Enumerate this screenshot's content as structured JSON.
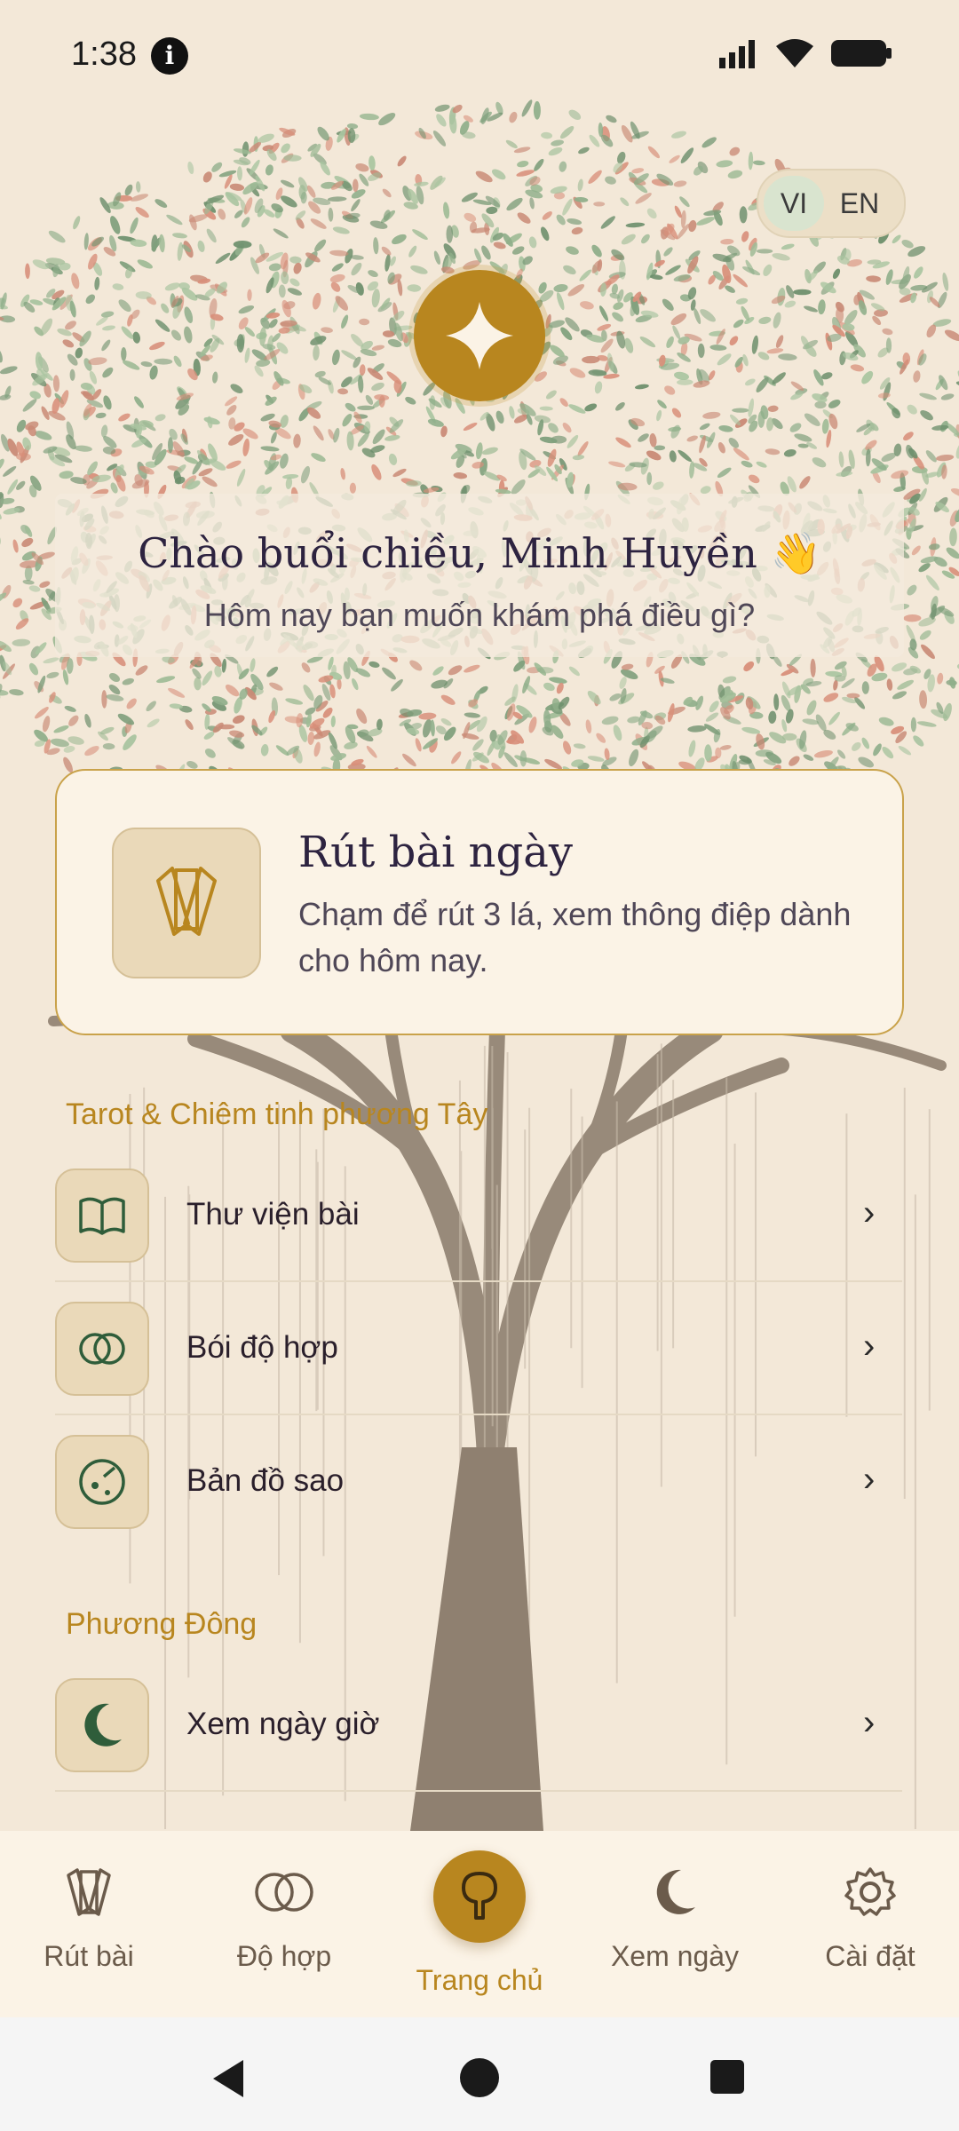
{
  "status_bar": {
    "time": "1:38",
    "info_icon": "info-icon",
    "icons": [
      "signal-icon",
      "wifi-icon",
      "battery-icon"
    ]
  },
  "language": {
    "vi": "VI",
    "en": "EN",
    "selected": "VI"
  },
  "greeting": {
    "title": "Chào buổi chiều, Minh Huyền 👋",
    "subtitle": "Hôm nay bạn muốn khám phá điều gì?"
  },
  "daily_card": {
    "title": "Rút bài ngày",
    "description": "Chạm để rút 3 lá, xem thông điệp dành cho hôm nay.",
    "icon": "cards-icon"
  },
  "sections": [
    {
      "title": "Tarot & Chiêm tinh phương Tây",
      "items": [
        {
          "label": "Thư viện bài",
          "icon": "book-icon"
        },
        {
          "label": "Bói độ hợp",
          "icon": "rings-icon"
        },
        {
          "label": "Bản đồ sao",
          "icon": "star-chart-icon"
        }
      ]
    },
    {
      "title": "Phương Đông",
      "items": [
        {
          "label": "Xem ngày giờ",
          "icon": "moon-icon"
        }
      ]
    }
  ],
  "bottom_nav": [
    {
      "label": "Rút bài",
      "icon": "cards-icon"
    },
    {
      "label": "Độ hợp",
      "icon": "rings-icon"
    },
    {
      "label": "Trang chủ",
      "icon": "tree-icon",
      "active": true
    },
    {
      "label": "Xem ngày",
      "icon": "moon-icon"
    },
    {
      "label": "Cài đặt",
      "icon": "gear-icon"
    }
  ],
  "colors": {
    "background": "#f3e8d8",
    "accent": "#b8861f",
    "icon_green": "#2f5d3a",
    "text": "#2a1f2b"
  }
}
